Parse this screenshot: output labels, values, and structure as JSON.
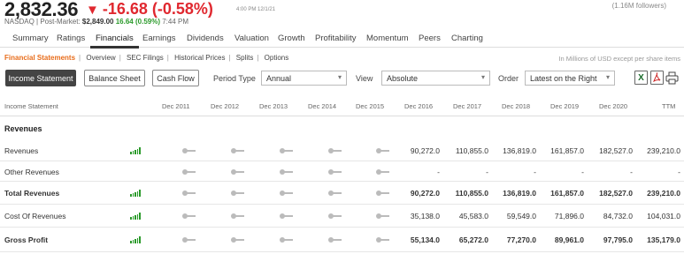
{
  "quote": {
    "price": "2,832.36",
    "change": "-16.68 (-0.58%)",
    "change_time": "4:00 PM 12/1/21",
    "followers": "(1.16M followers)",
    "exchange": "NASDAQ",
    "post_market_label": "Post-Market:",
    "post_price": "$2,849.00",
    "post_change": "16.64 (0.59%)",
    "post_time": "7:44 PM"
  },
  "main_tabs": [
    "Summary",
    "Ratings",
    "Financials",
    "Earnings",
    "Dividends",
    "Valuation",
    "Growth",
    "Profitability",
    "Momentum",
    "Peers",
    "Charting"
  ],
  "active_main_tab": "Financials",
  "sub_nav": [
    "Financial Statements",
    "Overview",
    "SEC Filings",
    "Historical Prices",
    "Splits",
    "Options"
  ],
  "units_note": "In Millions of USD except per share items",
  "toolbar": {
    "statements": [
      "Income Statement",
      "Balance Sheet",
      "Cash Flow"
    ],
    "period_label": "Period Type",
    "period_value": "Annual",
    "view_label": "View",
    "view_value": "Absolute",
    "order_label": "Order",
    "order_value": "Latest on the Right",
    "icons": [
      "excel-icon",
      "pdf-icon",
      "print-icon"
    ]
  },
  "table": {
    "header_label": "Income Statement",
    "columns": [
      "Dec 2011",
      "Dec 2012",
      "Dec 2013",
      "Dec 2014",
      "Dec 2015",
      "Dec 2016",
      "Dec 2017",
      "Dec 2018",
      "Dec 2019",
      "Dec 2020",
      "TTM"
    ],
    "section": "Revenues",
    "rows": [
      {
        "label": "Revenues",
        "values": [
          "90,272.0",
          "110,855.0",
          "136,819.0",
          "161,857.0",
          "182,527.0",
          "239,210.0"
        ]
      },
      {
        "label": "Other Revenues",
        "values": [
          "-",
          "-",
          "-",
          "-",
          "-",
          "-"
        ]
      },
      {
        "label": "Total Revenues",
        "values": [
          "90,272.0",
          "110,855.0",
          "136,819.0",
          "161,857.0",
          "182,527.0",
          "239,210.0"
        ]
      },
      {
        "label": "Cost Of Revenues",
        "values": [
          "35,138.0",
          "45,583.0",
          "59,549.0",
          "71,896.0",
          "84,732.0",
          "104,031.0"
        ]
      },
      {
        "label": "Gross Profit",
        "values": [
          "55,134.0",
          "65,272.0",
          "77,270.0",
          "89,961.0",
          "97,795.0",
          "135,179.0"
        ]
      }
    ]
  }
}
